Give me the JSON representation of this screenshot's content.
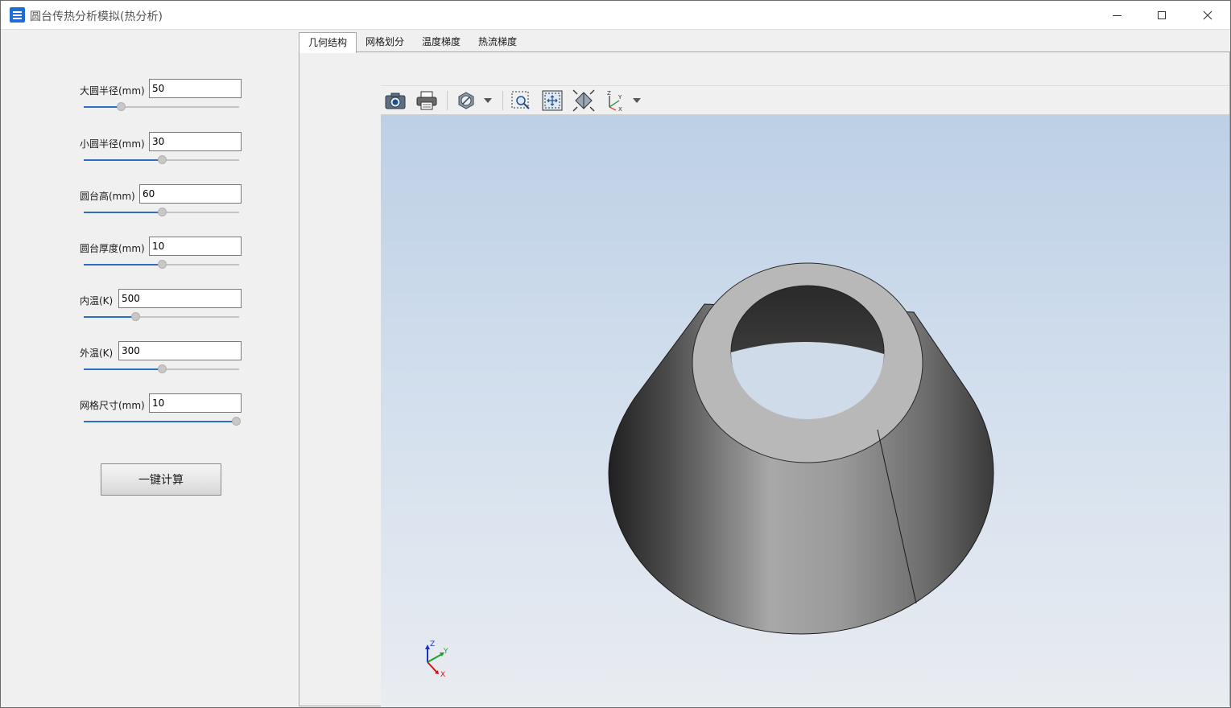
{
  "window": {
    "title": "圆台传热分析模拟(热分析)",
    "icon": "app-icon"
  },
  "params": [
    {
      "key": "big-radius",
      "label": "大圆半径(mm)",
      "value": "50",
      "slider": 0.24
    },
    {
      "key": "small-radius",
      "label": "小圆半径(mm)",
      "value": "30",
      "slider": 0.5
    },
    {
      "key": "height",
      "label": "圆台高(mm)",
      "value": "60",
      "slider": 0.5
    },
    {
      "key": "thickness",
      "label": "圆台厚度(mm)",
      "value": "10",
      "slider": 0.5
    },
    {
      "key": "inner-temp",
      "label": "内温(K)",
      "value": "500",
      "slider": 0.33
    },
    {
      "key": "outer-temp",
      "label": "外温(K)",
      "value": "300",
      "slider": 0.5
    },
    {
      "key": "mesh-size",
      "label": "网格尺寸(mm)",
      "value": "10",
      "slider": 0.98
    }
  ],
  "calc_button": "一键计算",
  "tabs": [
    {
      "label": "几何结构",
      "active": true
    },
    {
      "label": "网格划分",
      "active": false
    },
    {
      "label": "温度梯度",
      "active": false
    },
    {
      "label": "热流梯度",
      "active": false
    }
  ],
  "toolbar": {
    "icons": [
      "camera-icon",
      "print-icon",
      "clipping-plane-icon",
      "zoom-box-icon",
      "fit-all-icon",
      "view-isometric-icon",
      "axes-icon"
    ]
  },
  "axis_triad": {
    "x": "X",
    "y": "Y",
    "z": "Z"
  },
  "colors": {
    "accent": "#2a6fc1",
    "scene_top": "#bdd0e6",
    "scene_bottom": "#e9ecf1",
    "model_face": "#b8b8b8"
  }
}
